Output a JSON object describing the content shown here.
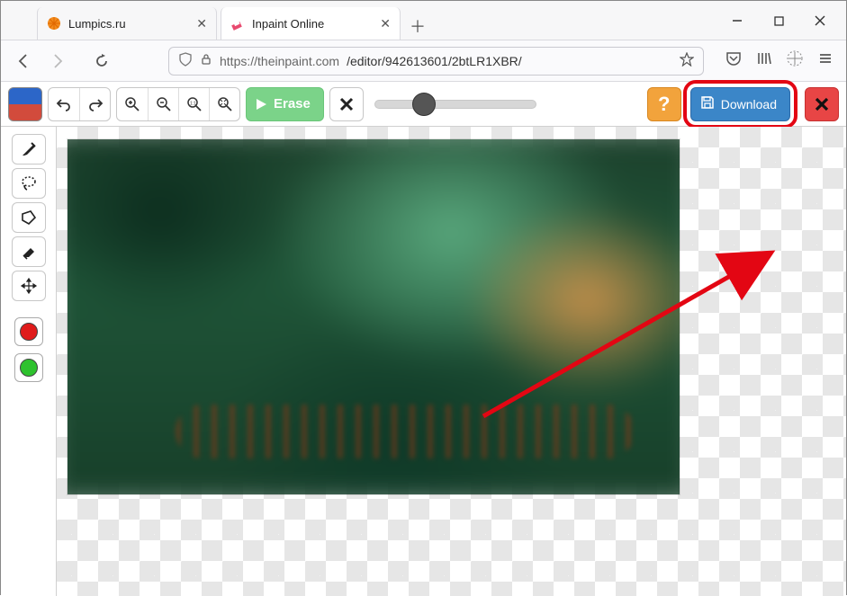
{
  "tabs": [
    {
      "title": "Lumpics.ru"
    },
    {
      "title": "Inpaint Online"
    }
  ],
  "url": {
    "scheme_host": "https://theinpaint.com",
    "path": "/editor/942613601/2btLR1XBR/"
  },
  "toolbar": {
    "erase_label": "Erase",
    "download_label": "Download",
    "help_label": "?"
  },
  "colors": {
    "highlight": "#e30613",
    "download_bg": "#3b86c8",
    "erase_bg": "#7bd389",
    "help_bg": "#f2a33c",
    "exit_bg": "#e84545",
    "marker_red": "#e01b1b",
    "marker_green": "#2ec22e"
  }
}
